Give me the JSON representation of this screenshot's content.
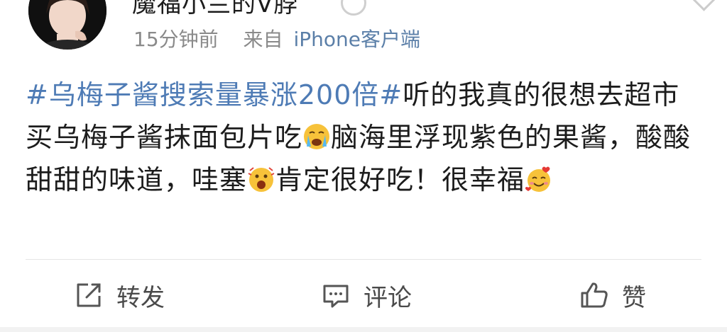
{
  "post": {
    "username": "魔福小兰的V脖",
    "time": "15分钟前",
    "source_prefix": "来自",
    "source_device": "iPhone客户端",
    "hashtag": "#乌梅子酱搜索量暴涨200倍#",
    "text_1": "听的我真的很想去超市买乌梅子酱抹面包片吃",
    "emoji_1": "crying-face-emoji",
    "text_2": "脑海里浮现紫色的果酱，酸酸甜甜的味道，哇塞",
    "emoji_2": "wow-face-emoji",
    "text_3": "肯定很好吃！很幸福",
    "emoji_3": "smiling-face-with-hearts-emoji"
  },
  "actions": {
    "repost_label": "转发",
    "comment_label": "评论",
    "like_label": "赞"
  },
  "colors": {
    "hashtag": "#4e7bb5",
    "device": "#5b7fa8",
    "meta": "#8a8a8a",
    "text": "#1c1c1c",
    "action": "#4a4a4a"
  }
}
